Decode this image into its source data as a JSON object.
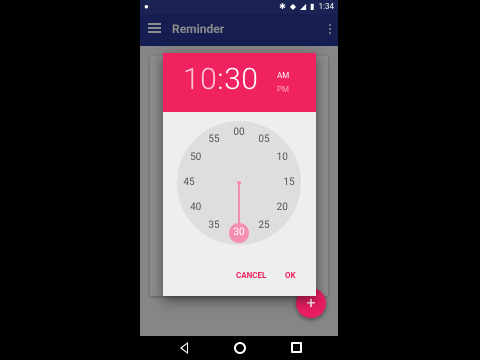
{
  "status_bar": {
    "time": "1:34",
    "icons": [
      "notification-icon",
      "bluetooth-icon",
      "wifi-icon",
      "signal-icon",
      "battery-icon"
    ]
  },
  "app_bar": {
    "title": "Reminder"
  },
  "time_picker": {
    "hour": "10",
    "separator": ":",
    "minute": "30",
    "am_label": "AM",
    "pm_label": "PM",
    "selected_period": "AM",
    "selected_minute": "30",
    "minute_labels": [
      "00",
      "05",
      "10",
      "15",
      "20",
      "25",
      "30",
      "35",
      "40",
      "45",
      "50",
      "55"
    ],
    "cancel_label": "CANCEL",
    "ok_label": "OK"
  },
  "colors": {
    "accent": "#f0225f",
    "primary": "#283593",
    "primary_dark": "#1b2354",
    "dial": "#dedede",
    "selection": "#f48fb1"
  }
}
